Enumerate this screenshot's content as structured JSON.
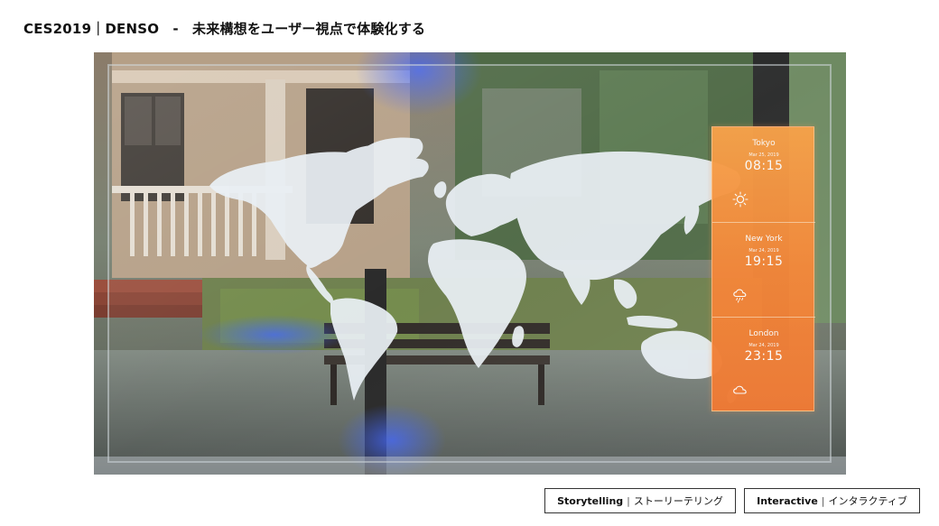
{
  "header": {
    "title": "CES2019｜DENSO　-　未来構想をユーザー視点で体験化する"
  },
  "hero": {
    "weather_cards": [
      {
        "city": "Tokyo",
        "date": "Mar 25, 2019",
        "time": "08:15",
        "icon": "sun-icon"
      },
      {
        "city": "New York",
        "date": "Mar 24, 2019",
        "time": "19:15",
        "icon": "rain-cloud-icon"
      },
      {
        "city": "London",
        "date": "Mar 24, 2019",
        "time": "23:15",
        "icon": "cloud-icon"
      }
    ],
    "colors": {
      "panel_orange": "#f3883b",
      "map_white": "#e8eef3"
    }
  },
  "tags": [
    {
      "en": "Storytelling",
      "sep": "|",
      "ja": "ストーリーテリング"
    },
    {
      "en": "Interactive",
      "sep": "|",
      "ja": "インタラクティブ"
    }
  ]
}
